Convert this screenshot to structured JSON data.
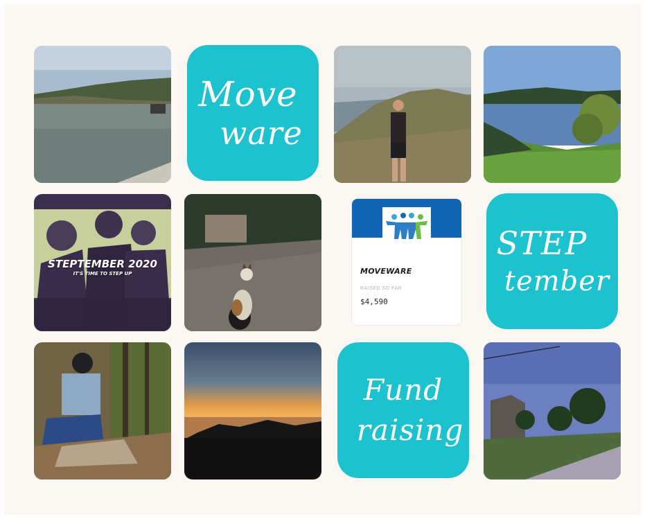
{
  "tiles": {
    "move_ware": {
      "line1": "Move",
      "line2": "ware"
    },
    "step_tember": {
      "line1": "STEP",
      "line2": "tember"
    },
    "fund_raising": {
      "line1": "Fund",
      "line2": "raising"
    }
  },
  "poster": {
    "title": "STEPTEMBER 2020",
    "subtitle": "IT'S TIME TO STEP UP"
  },
  "fundraising_card": {
    "team_name": "MOVEWARE",
    "raised_label": "RAISED SO FAR",
    "amount": "$4,590"
  },
  "colors": {
    "teal": "#1cc3cf",
    "card_banner": "#1264b5",
    "background": "#fbf8f3"
  }
}
